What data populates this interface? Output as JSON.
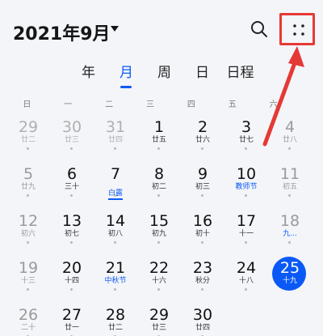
{
  "header": {
    "month_title": "2021年9月",
    "search_icon": "search-icon",
    "more_icon": "more-dots-icon"
  },
  "tabs": [
    {
      "label": "年",
      "active": false
    },
    {
      "label": "月",
      "active": true
    },
    {
      "label": "周",
      "active": false
    },
    {
      "label": "日",
      "active": false
    },
    {
      "label": "日程",
      "active": false
    }
  ],
  "weekdays": [
    "日",
    "一",
    "二",
    "三",
    "四",
    "五",
    "六"
  ],
  "weeks": [
    [
      {
        "num": "29",
        "lunar": "廿二",
        "other": true
      },
      {
        "num": "30",
        "lunar": "廿三",
        "other": true
      },
      {
        "num": "31",
        "lunar": "廿四",
        "other": true
      },
      {
        "num": "1",
        "lunar": "廿五"
      },
      {
        "num": "2",
        "lunar": "廿六"
      },
      {
        "num": "3",
        "lunar": "廿七"
      },
      {
        "num": "4",
        "lunar": "廿八",
        "weekend": true
      }
    ],
    [
      {
        "num": "5",
        "lunar": "廿九",
        "weekend": true
      },
      {
        "num": "6",
        "lunar": "三十"
      },
      {
        "num": "7",
        "lunar": "白露",
        "holiday": true,
        "underline": true
      },
      {
        "num": "8",
        "lunar": "初二"
      },
      {
        "num": "9",
        "lunar": "初三"
      },
      {
        "num": "10",
        "lunar": "教师节",
        "holiday": true
      },
      {
        "num": "11",
        "lunar": "初五",
        "weekend": true
      }
    ],
    [
      {
        "num": "12",
        "lunar": "初六",
        "weekend": true
      },
      {
        "num": "13",
        "lunar": "初七"
      },
      {
        "num": "14",
        "lunar": "初八"
      },
      {
        "num": "15",
        "lunar": "初九"
      },
      {
        "num": "16",
        "lunar": "初十"
      },
      {
        "num": "17",
        "lunar": "十一"
      },
      {
        "num": "18",
        "lunar": "九...",
        "weekend": true,
        "holiday": true
      }
    ],
    [
      {
        "num": "19",
        "lunar": "十三",
        "weekend": true
      },
      {
        "num": "20",
        "lunar": "十四"
      },
      {
        "num": "21",
        "lunar": "中秋节",
        "holiday": true
      },
      {
        "num": "22",
        "lunar": "十六"
      },
      {
        "num": "23",
        "lunar": "秋分"
      },
      {
        "num": "24",
        "lunar": "十八"
      },
      {
        "num": "25",
        "lunar": "十九",
        "today": true
      }
    ],
    [
      {
        "num": "26",
        "lunar": "二十",
        "weekend": true
      },
      {
        "num": "27",
        "lunar": "廿一"
      },
      {
        "num": "28",
        "lunar": "廿二"
      },
      {
        "num": "29",
        "lunar": "廿三"
      },
      {
        "num": "30",
        "lunar": "廿四"
      },
      {
        "num": "",
        "lunar": ""
      },
      {
        "num": "",
        "lunar": ""
      }
    ]
  ],
  "colors": {
    "accent": "#0a59f7",
    "annotation": "#e53935"
  }
}
